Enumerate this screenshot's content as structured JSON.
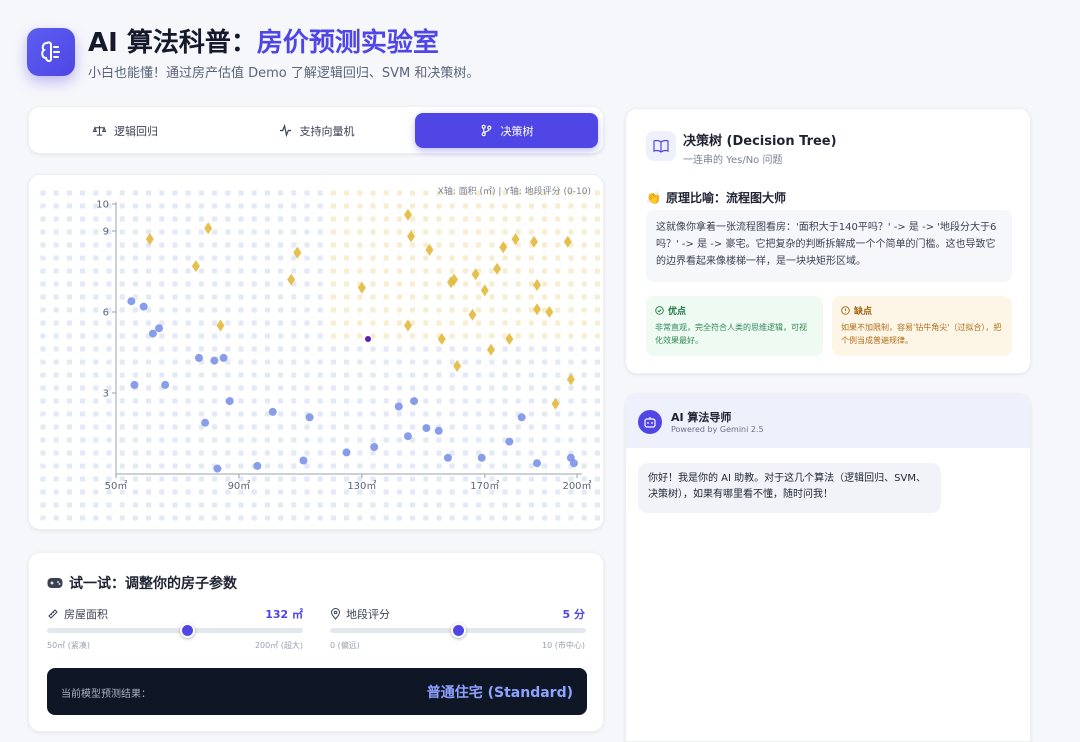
{
  "header": {
    "title_prefix": "AI 算法科普：",
    "title_highlight": "房价预测实验室",
    "subtitle": "小白也能懂！通过房产估值 Demo 了解逻辑回归、SVM 和决策树。"
  },
  "tabs": [
    {
      "label": "逻辑回归",
      "icon": "scale-icon",
      "active": false
    },
    {
      "label": "支持向量机",
      "icon": "activity-icon",
      "active": false
    },
    {
      "label": "决策树",
      "icon": "git-branch-icon",
      "active": true
    }
  ],
  "chart_data": {
    "type": "scatter",
    "axis_note": "X轴: 面积 (㎡) | Y轴: 地段评分 (0-10)",
    "xlim": [
      50,
      200
    ],
    "ylim": [
      0,
      10
    ],
    "x_ticks": [
      "50㎡",
      "90㎡",
      "130㎡",
      "170㎡",
      "200㎡"
    ],
    "y_ticks": [
      "3",
      "6",
      "9",
      "10"
    ],
    "grid": "dot-matrix background",
    "series": [
      {
        "shape": "circle",
        "color": "#7b93e8",
        "points": [
          [
            55,
            6.4
          ],
          [
            59,
            6.2
          ],
          [
            62,
            5.2
          ],
          [
            64,
            5.4
          ],
          [
            56,
            3.3
          ],
          [
            66,
            3.3
          ],
          [
            77,
            4.3
          ],
          [
            79,
            1.9
          ],
          [
            82,
            4.2
          ],
          [
            85,
            4.3
          ],
          [
            87,
            2.7
          ],
          [
            83,
            0.2
          ],
          [
            96,
            0.3
          ],
          [
            101,
            2.3
          ],
          [
            111,
            0.5
          ],
          [
            113,
            2.1
          ],
          [
            125,
            0.8
          ],
          [
            134,
            1.0
          ],
          [
            142,
            2.5
          ],
          [
            145,
            1.4
          ],
          [
            147,
            2.7
          ],
          [
            151,
            1.7
          ],
          [
            155,
            1.6
          ],
          [
            158,
            0.6
          ],
          [
            169,
            0.6
          ],
          [
            178,
            1.2
          ],
          [
            182,
            2.1
          ],
          [
            187,
            0.4
          ],
          [
            198,
            0.6
          ],
          [
            199,
            0.4
          ]
        ]
      },
      {
        "shape": "diamond",
        "color": "#e3b93c",
        "points": [
          [
            61,
            8.7
          ],
          [
            80,
            9.1
          ],
          [
            76,
            7.7
          ],
          [
            84,
            5.5
          ],
          [
            107,
            7.2
          ],
          [
            109,
            8.2
          ],
          [
            130,
            6.9
          ],
          [
            145,
            9.6
          ],
          [
            146,
            8.8
          ],
          [
            145,
            5.5
          ],
          [
            152,
            8.3
          ],
          [
            156,
            5.0
          ],
          [
            159,
            7.1
          ],
          [
            160,
            7.2
          ],
          [
            161,
            4.0
          ],
          [
            166,
            5.9
          ],
          [
            167,
            7.4
          ],
          [
            170,
            6.8
          ],
          [
            172,
            4.6
          ],
          [
            174,
            7.6
          ],
          [
            176,
            8.4
          ],
          [
            178,
            5.0
          ],
          [
            180,
            8.7
          ],
          [
            186,
            8.6
          ],
          [
            187,
            7.0
          ],
          [
            187,
            6.1
          ],
          [
            191,
            6.0
          ],
          [
            197,
            8.6
          ],
          [
            198,
            3.5
          ],
          [
            193,
            2.6
          ]
        ]
      },
      {
        "shape": "circle",
        "color": "#5b21b6",
        "label": "current",
        "points": [
          [
            132,
            5.0
          ]
        ]
      }
    ]
  },
  "controls": {
    "title": "试一试：调整你的房子参数",
    "area": {
      "label": "房屋面积",
      "value": "132 ㎡",
      "min_label": "50㎡ (紧凑)",
      "max_label": "200㎡ (超大)",
      "fraction": 0.55
    },
    "location": {
      "label": "地段评分",
      "value": "5 分",
      "min_label": "0 (偏远)",
      "max_label": "10 (市中心)",
      "fraction": 0.5
    },
    "result_label": "当前模型预测结果：",
    "result_value": "普通住宅 (Standard)"
  },
  "info": {
    "title": "决策树 (Decision Tree)",
    "subtitle": "一连串的 Yes/No 问题",
    "principle_title": "原理比喻：流程图大师",
    "description": "这就像你拿着一张流程图看房：'面积大于140平吗？' -> 是 -> '地段分大于6吗？' -> 是 -> 豪宅。它把复杂的判断拆解成一个个简单的门槛。这也导致它的边界看起来像楼梯一样，是一块块矩形区域。",
    "pros_title": "优点",
    "pros": "非常直观，完全符合人类的思维逻辑，可视化效果最好。",
    "cons_title": "缺点",
    "cons": "如果不加限制，容易'钻牛角尖'（过拟合），把个例当成普遍规律。"
  },
  "ai": {
    "title": "AI 算法导师",
    "subtitle": "Powered by Gemini 2.5",
    "message": "你好！我是你的 AI 助教。对于这几个算法（逻辑回归、SVM、决策树），如果有哪里看不懂，随时问我！"
  }
}
